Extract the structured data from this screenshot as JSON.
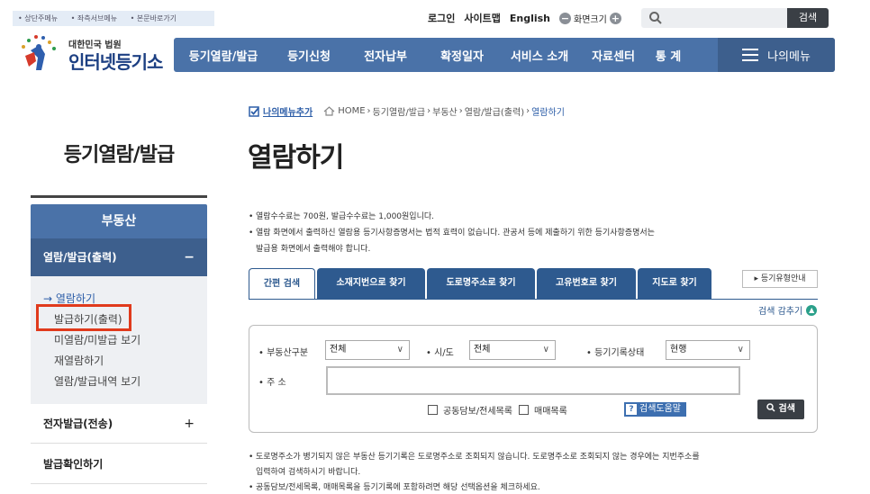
{
  "skip_links": [
    "상단주메뉴",
    "좌측서브메뉴",
    "본문바로가기"
  ],
  "util": {
    "login": "로그인",
    "sitemap": "사이트맵",
    "english": "English",
    "font_size": "화면크기",
    "minus": "−",
    "plus": "+"
  },
  "search": {
    "placeholder": "",
    "button": "검색"
  },
  "logo": {
    "small": "대한민국 법원",
    "big": "인터넷등기소"
  },
  "gnb": {
    "items": [
      "등기열람/발급",
      "등기신청",
      "전자납부",
      "확정일자",
      "서비스 소개",
      "자료센터",
      "통 계"
    ],
    "my_menu": "나의메뉴"
  },
  "breadcrumb": {
    "add_menu": "나의메뉴추가",
    "items": [
      "HOME",
      "등기열람/발급",
      "부동산",
      "열람/발급(출력)"
    ],
    "current": "열람하기"
  },
  "page_title": "열람하기",
  "lnb": {
    "title": "등기열람/발급",
    "head": "부동산",
    "sub": "열람/발급(출력)",
    "sub_toggle": "−",
    "items": [
      "열람하기",
      "발급하기(출력)",
      "미열람/미발급 보기",
      "재열람하기",
      "열람/발급내역 보기"
    ],
    "rows": [
      {
        "label": "전자발급(전송)",
        "toggle": "+"
      },
      {
        "label": "발급확인하기",
        "toggle": ""
      }
    ]
  },
  "notices_top": [
    "열람수수료는 700원, 발급수수료는 1,000원입니다.",
    "열람 화면에서 출력하신 열람용 등기사항증명서는 법적 효력이 없습니다. 관공서 등에 제출하기 위한 등기사항증명서는",
    "발급용 화면에서 출력해야 합니다."
  ],
  "tabs": [
    "간편 검색",
    "소재지번으로 찾기",
    "도로명주소로 찾기",
    "고유번호로 찾기",
    "지도로 찾기"
  ],
  "guide_button": "등기유형안내",
  "fold_label": "검색 감추기",
  "form": {
    "property_type_label": "부동산구분",
    "property_type_value": "전체",
    "sido_label": "시/도",
    "sido_value": "전체",
    "record_status_label": "등기기록상태",
    "record_status_value": "현행",
    "address_label": "주 소",
    "address_value": "",
    "check_joint": "공동담보/전세목록",
    "check_sale": "매매목록",
    "help": "검색도움말",
    "search": "검색"
  },
  "notices_bottom": [
    "도로명주소가 병기되지 않은 부동산 등기기록은 도로명주소로 조회되지 않습니다. 도로명주소로 조회되지 않는 경우에는 지번주소를",
    "입력하여 검색하시기 바랍니다.",
    "공동담보/전세목록, 매매목록을 등기기록에 포함하려면 해당 선택옵션을 체크하세요."
  ],
  "colors": {
    "nav": "#4a72a8",
    "nav_dark": "#3d5f8d",
    "tab": "#2e5a8f",
    "highlight": "#e03a1c"
  }
}
